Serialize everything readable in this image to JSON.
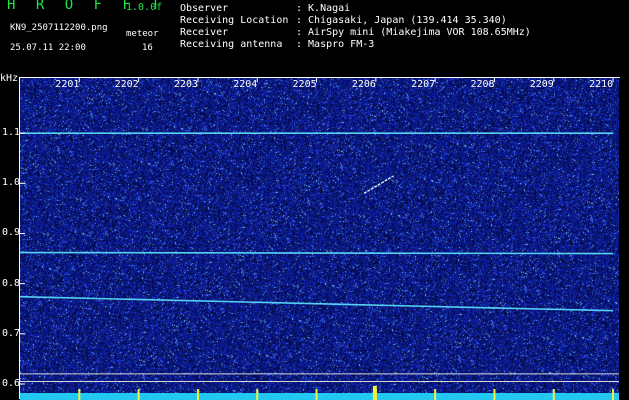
{
  "header": {
    "title": "H R O F F T",
    "version": "1.0.0f",
    "filename": "KN9_2507112200.png",
    "datetime": "25.07.11 22:00",
    "meteor_label": "meteor",
    "meteor_count": "16",
    "info": [
      {
        "key": "Observer",
        "value": ": K.Nagai"
      },
      {
        "key": "Receiving Location",
        "value": ": Chigasaki, Japan (139.414 35.340)"
      },
      {
        "key": "Receiver",
        "value": ": AirSpy mini (Miakejima VOR 108.65MHz)"
      },
      {
        "key": "Receiving antenna",
        "value": ": Maspro FM-3"
      }
    ]
  },
  "colors": {
    "background": "#000000",
    "plot_bg": "#0b1a8a",
    "signal": "#5fe6ff",
    "header_green": "#17e64a",
    "marker_yellow": "#f2f23a",
    "bottom_band": "#22c8f0"
  },
  "chart_data": {
    "type": "heatmap",
    "ylabel": "kHz",
    "x_ticks": [
      "2201",
      "2202",
      "2203",
      "2204",
      "2205",
      "2206",
      "2207",
      "2208",
      "2209",
      "2210"
    ],
    "y_ticks": [
      "1.1",
      "1.0",
      "0.9",
      "0.8",
      "0.7",
      "0.6"
    ],
    "ylim": [
      0.58,
      1.21
    ],
    "signal_lines": [
      {
        "from": [
          2200.0,
          1.1
        ],
        "to": [
          2210.0,
          1.1
        ]
      },
      {
        "from": [
          2200.0,
          0.862
        ],
        "to": [
          2210.0,
          0.86
        ]
      },
      {
        "from": [
          2200.0,
          0.774
        ],
        "to": [
          2210.0,
          0.746
        ]
      }
    ],
    "meteor_echoes": [
      {
        "from": [
          2205.8,
          0.98
        ],
        "to": [
          2206.3,
          1.015
        ]
      }
    ],
    "reference_lines": [
      0.62,
      0.605
    ]
  }
}
